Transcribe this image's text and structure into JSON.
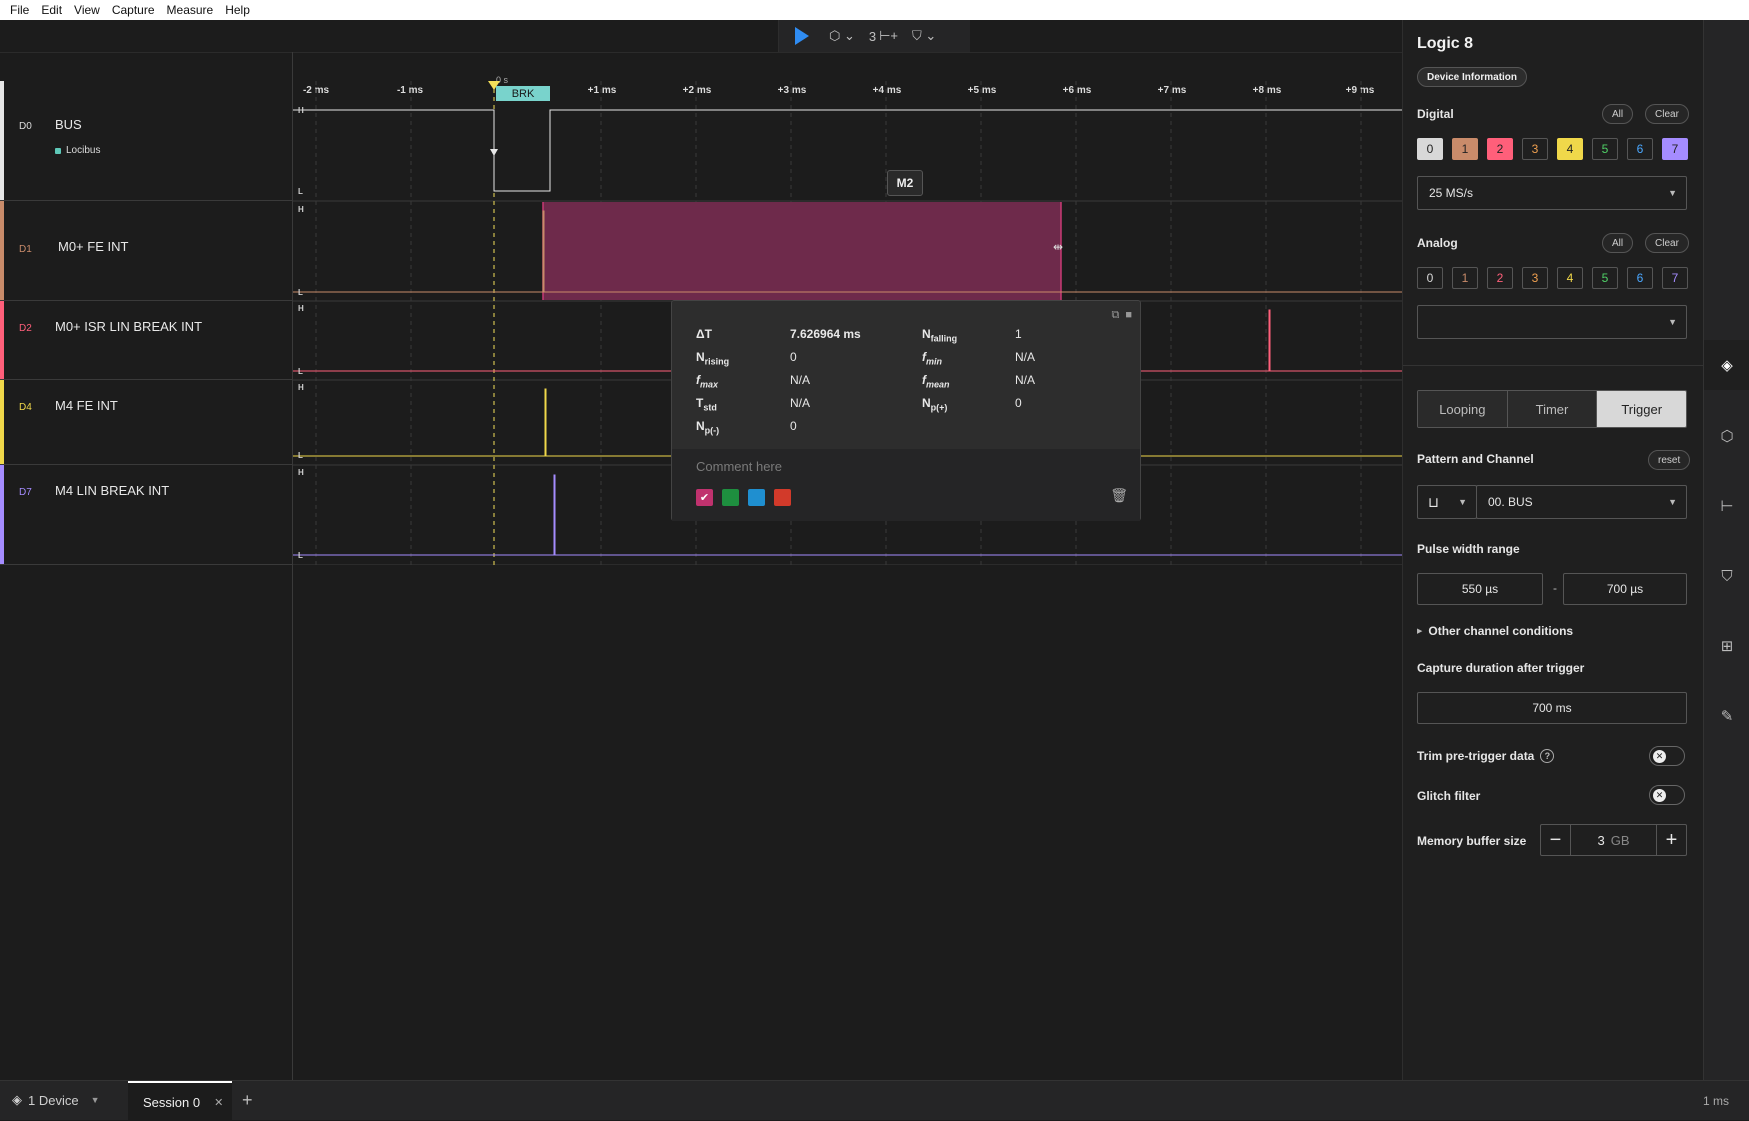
{
  "menu": [
    "File",
    "Edit",
    "View",
    "Capture",
    "Measure",
    "Help"
  ],
  "toolbar": {
    "play_icon": "play-icon",
    "decode_icon": "protocol-icon",
    "measure_icon": "measure-icon",
    "measure_num": "3",
    "marker_icon": "marker-icon"
  },
  "timeline": {
    "zero_label": "0 s",
    "ticks": [
      "-2 ms",
      "-1 ms",
      "0 s",
      "+1 ms",
      "+2 ms",
      "+3 ms",
      "+4 ms",
      "+5 ms",
      "+6 ms",
      "+7 ms",
      "+8 ms",
      "+9 ms"
    ],
    "trigger_label": "T",
    "brk_label": "BRK",
    "marker_label": "M2"
  },
  "channels": [
    {
      "id": "D0",
      "name": "BUS",
      "sub": "Locibus",
      "color": "#e6e6e6"
    },
    {
      "id": "D1",
      "name": "M0+ FE INT",
      "color": "#c98b6a"
    },
    {
      "id": "D2",
      "name": "M0+ ISR LIN BREAK INT",
      "color": "#ff5f7a"
    },
    {
      "id": "D4",
      "name": "M4 FE INT",
      "color": "#f0d84a"
    },
    {
      "id": "D7",
      "name": "M4 LIN BREAK INT",
      "color": "#a58cff"
    }
  ],
  "hl": {
    "high": "H",
    "low": "L"
  },
  "measurement": {
    "dt_label": "ΔT",
    "dt_value": "7.626964 ms",
    "nfalling_label": "N",
    "nfalling_sub": "falling",
    "nfalling_value": "1",
    "nrising_label": "N",
    "nrising_sub": "rising",
    "nrising_value": "0",
    "fmin_label": "f",
    "fmin_sub": "min",
    "fmin_value": "N/A",
    "fmax_label": "f",
    "fmax_sub": "max",
    "fmax_value": "N/A",
    "fmean_label": "f",
    "fmean_sub": "mean",
    "fmean_value": "N/A",
    "tstd_label": "T",
    "tstd_sub": "std",
    "tstd_value": "N/A",
    "npplus_label": "N",
    "npplus_sub": "p(+)",
    "npplus_value": "0",
    "npminus_label": "N",
    "npminus_sub": "p(-)",
    "npminus_value": "0",
    "comment_placeholder": "Comment here",
    "swatch_colors": [
      "#c0326e",
      "#1e8f3f",
      "#1f8fd0",
      "#d23a2a"
    ]
  },
  "right_panel": {
    "title": "Logic 8",
    "device_info": "Device Information",
    "digital_label": "Digital",
    "all": "All",
    "clear": "Clear",
    "digital_channels": [
      "0",
      "1",
      "2",
      "3",
      "4",
      "5",
      "6",
      "7"
    ],
    "sample_rate": "25 MS/s",
    "analog_label": "Analog",
    "analog_channels": [
      "0",
      "1",
      "2",
      "3",
      "4",
      "5",
      "6",
      "7"
    ],
    "analog_rate": "",
    "modes": [
      "Looping",
      "Timer",
      "Trigger"
    ],
    "pattern_label": "Pattern and Channel",
    "reset": "reset",
    "channel_select": "00.  BUS",
    "pulse_label": "Pulse width range",
    "pulse_min": "550 µs",
    "pulse_dash": "-",
    "pulse_max": "700 µs",
    "other_conditions": "Other channel conditions",
    "capture_label": "Capture duration after trigger",
    "capture_value": "700 ms",
    "trim_label": "Trim pre-trigger data",
    "glitch_label": "Glitch filter",
    "memory_label": "Memory buffer size",
    "memory_value": "3",
    "memory_unit": "GB"
  },
  "statusbar": {
    "device": "1 Device",
    "session": "Session 0",
    "scale": "1 ms"
  }
}
